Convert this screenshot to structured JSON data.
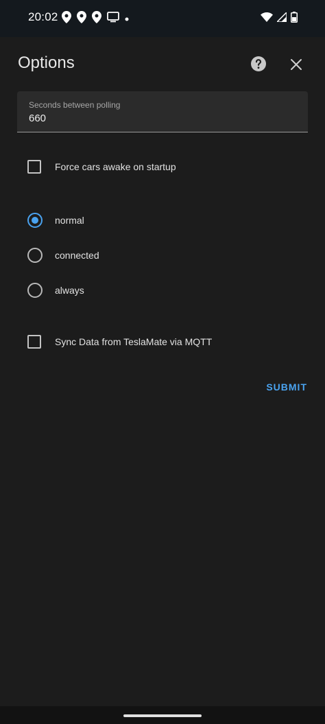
{
  "status_bar": {
    "time": "20:02",
    "left_icons": [
      "location-icon",
      "location-icon",
      "location-icon",
      "cast-icon",
      "dot-icon"
    ],
    "right_icons": [
      "wifi-icon",
      "signal-icon",
      "battery-icon"
    ]
  },
  "dialog": {
    "title": "Options",
    "help_icon": "help-circle-icon",
    "close_icon": "close-icon",
    "polling_field": {
      "label": "Seconds between polling",
      "value": "660"
    },
    "force_awake": {
      "label": "Force cars awake on startup",
      "checked": false
    },
    "mode_options": [
      {
        "label": "normal",
        "checked": true
      },
      {
        "label": "connected",
        "checked": false
      },
      {
        "label": "always",
        "checked": false
      }
    ],
    "sync_mqtt": {
      "label": "Sync Data from TeslaMate via MQTT",
      "checked": false
    },
    "submit_label": "SUBMIT"
  },
  "colors": {
    "accent": "#4aa3f0",
    "background": "#1c1c1c",
    "status_bar": "#14191e",
    "field_background": "#2b2b2b"
  }
}
